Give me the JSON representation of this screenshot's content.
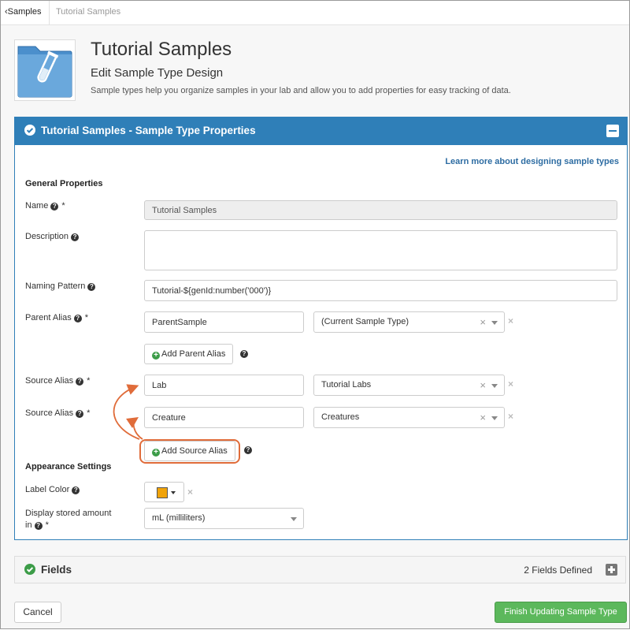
{
  "breadcrumb": {
    "back_label": "Samples",
    "current": "Tutorial Samples"
  },
  "header": {
    "title": "Tutorial Samples",
    "subtitle": "Edit Sample Type Design",
    "description": "Sample types help you organize samples in your lab and allow you to add properties for easy tracking of data."
  },
  "properties_panel": {
    "title": "Tutorial Samples - Sample Type Properties",
    "learn_more": "Learn more about designing sample types",
    "general_heading": "General Properties",
    "name_label": "Name",
    "name_value": "Tutorial Samples",
    "description_label": "Description",
    "description_value": "",
    "naming_pattern_label": "Naming Pattern",
    "naming_pattern_value": "Tutorial-${genId:number('000')}",
    "parent_alias_label": "Parent Alias",
    "parent_alias_value": "ParentSample",
    "parent_alias_select": "(Current Sample Type)",
    "add_parent_alias": "Add Parent Alias",
    "source_aliases": [
      {
        "label": "Source Alias",
        "value": "Lab",
        "select": "Tutorial Labs"
      },
      {
        "label": "Source Alias",
        "value": "Creature",
        "select": "Creatures"
      }
    ],
    "add_source_alias": "Add Source Alias",
    "appearance_heading": "Appearance Settings",
    "label_color_label": "Label Color",
    "label_color_value": "#f0a30a",
    "stored_amount_label_line1": "Display stored amount",
    "stored_amount_label_line2": "in",
    "stored_amount_value": "mL (milliliters)",
    "required_mark": "*"
  },
  "fields_panel": {
    "title": "Fields",
    "count_text": "2 Fields Defined"
  },
  "footer": {
    "cancel_label": "Cancel",
    "finish_label": "Finish Updating Sample Type"
  },
  "colors": {
    "accent": "#2f7fb8",
    "success": "#5cb85c",
    "annotation": "#e06c3a"
  }
}
